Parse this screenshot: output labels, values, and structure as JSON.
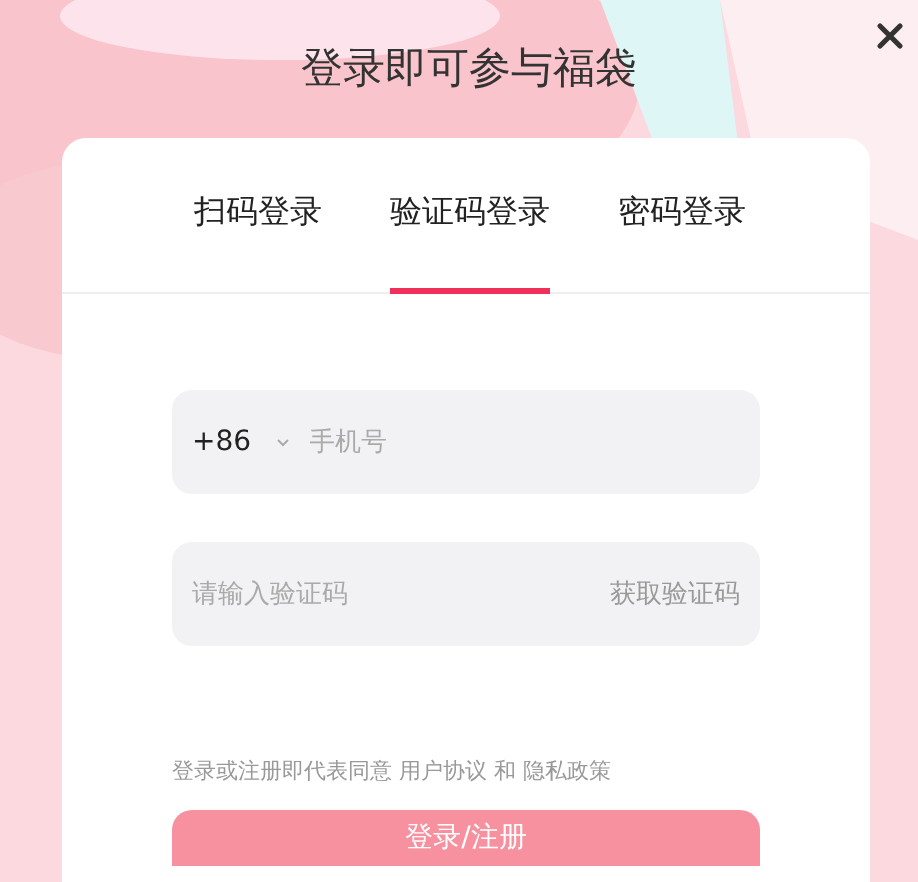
{
  "title": "登录即可参与福袋",
  "tabs": [
    {
      "label": "扫码登录",
      "selected": false
    },
    {
      "label": "验证码登录",
      "selected": true
    },
    {
      "label": "密码登录",
      "selected": false
    }
  ],
  "phone_field": {
    "country_code": "+86",
    "placeholder": "手机号"
  },
  "code_field": {
    "placeholder": "请输入验证码",
    "get_code_button": "获取验证码"
  },
  "agreement": {
    "text": "登录或注册即代表同意",
    "links": [
      "用户协议",
      "隐私政策"
    ],
    "conjunction": "和"
  },
  "submit_button": {
    "label": "登录/注册",
    "disabled": true
  }
}
